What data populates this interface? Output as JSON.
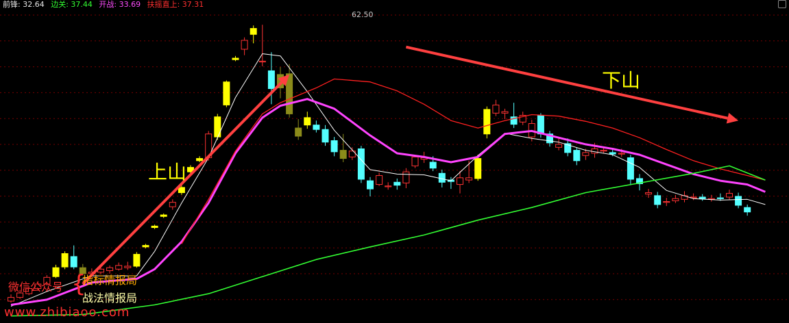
{
  "legend": [
    {
      "label": "前锋: 32.64",
      "color": "#e6e6e6"
    },
    {
      "label": "边关: 37.44",
      "color": "#32ff32"
    },
    {
      "label": "开战: 33.69",
      "color": "#ff4cff"
    },
    {
      "label": "扶摇直上: 37.31",
      "color": "#ff3030"
    }
  ],
  "annotations": {
    "up": "上山",
    "down": "下山",
    "peak": "62.50",
    "wechat": "微信公众号",
    "brace": "{",
    "line1": "指标情报局",
    "line2": "战法情报局",
    "url": "www.zhibiaoo.com"
  },
  "colors": {
    "background": "#000000",
    "grid": "#7a0000",
    "up_candle": "#ff3333",
    "down_candle": "#54ffff",
    "yellow_candle": "#ffff00",
    "olive_candle": "#8b8b1a",
    "arrow": "#ff4040"
  },
  "chart_data": {
    "type": "candlestick",
    "title": "",
    "ylim": [
      23,
      65
    ],
    "grid": true,
    "candles": [
      {
        "o": 25.3,
        "c": 25.8,
        "h": 26.2,
        "l": 25.1,
        "k": "up"
      },
      {
        "o": 25.8,
        "c": 26.4,
        "h": 26.8,
        "l": 25.6,
        "k": "up"
      },
      {
        "o": 26.3,
        "c": 27.0,
        "h": 27.3,
        "l": 26.1,
        "k": "up"
      },
      {
        "o": 27.0,
        "c": 27.6,
        "h": 28.0,
        "l": 26.8,
        "k": "up"
      },
      {
        "o": 27.6,
        "c": 28.5,
        "h": 28.8,
        "l": 27.4,
        "k": "up"
      },
      {
        "o": 28.6,
        "c": 29.8,
        "h": 30.2,
        "l": 28.4,
        "k": "yellow"
      },
      {
        "o": 29.9,
        "c": 31.7,
        "h": 32.0,
        "l": 29.6,
        "k": "yellow"
      },
      {
        "o": 31.3,
        "c": 29.9,
        "h": 32.8,
        "l": 29.6,
        "k": "down"
      },
      {
        "o": 29.8,
        "c": 29.0,
        "h": 30.3,
        "l": 28.8,
        "k": "olive"
      },
      {
        "o": 29.0,
        "c": 29.2,
        "h": 29.7,
        "l": 28.7,
        "k": "up"
      },
      {
        "o": 29.2,
        "c": 29.6,
        "h": 30.0,
        "l": 28.9,
        "k": "up"
      },
      {
        "o": 29.4,
        "c": 29.8,
        "h": 30.1,
        "l": 29.0,
        "k": "up"
      },
      {
        "o": 29.6,
        "c": 30.1,
        "h": 30.5,
        "l": 29.4,
        "k": "up"
      },
      {
        "o": 29.8,
        "c": 30.0,
        "h": 30.6,
        "l": 29.5,
        "k": "up"
      },
      {
        "o": 30.0,
        "c": 31.6,
        "h": 31.9,
        "l": 29.8,
        "k": "yellow"
      },
      {
        "o": 32.6,
        "c": 32.8,
        "h": 33.0,
        "l": 32.4,
        "k": "yellow"
      },
      {
        "o": 35.2,
        "c": 35.4,
        "h": 35.6,
        "l": 35.0,
        "k": "yellow"
      },
      {
        "o": 36.7,
        "c": 36.9,
        "h": 37.1,
        "l": 36.5,
        "k": "yellow"
      },
      {
        "o": 38.0,
        "c": 38.6,
        "h": 39.0,
        "l": 37.6,
        "k": "up"
      },
      {
        "o": 39.9,
        "c": 40.6,
        "h": 41.0,
        "l": 39.6,
        "k": "yellow"
      },
      {
        "o": 42.7,
        "c": 43.3,
        "h": 43.6,
        "l": 42.4,
        "k": "yellow"
      },
      {
        "o": 44.2,
        "c": 44.5,
        "h": 44.8,
        "l": 44.0,
        "k": "yellow"
      },
      {
        "o": 44.6,
        "c": 47.8,
        "h": 48.2,
        "l": 44.2,
        "k": "up"
      },
      {
        "o": 47.4,
        "c": 50.1,
        "h": 50.5,
        "l": 47.0,
        "k": "yellow"
      },
      {
        "o": 51.7,
        "c": 54.8,
        "h": 55.0,
        "l": 51.4,
        "k": "yellow"
      },
      {
        "o": 57.8,
        "c": 58.0,
        "h": 58.3,
        "l": 57.6,
        "k": "yellow"
      },
      {
        "o": 59.2,
        "c": 60.4,
        "h": 60.8,
        "l": 58.4,
        "k": "up"
      },
      {
        "o": 61.2,
        "c": 62.0,
        "h": 62.4,
        "l": 60.0,
        "k": "yellow"
      },
      {
        "o": 57.6,
        "c": 57.6,
        "h": 62.5,
        "l": 56.9,
        "k": "up"
      },
      {
        "o": 53.9,
        "c": 56.3,
        "h": 58.8,
        "l": 51.8,
        "k": "down"
      },
      {
        "o": 54.0,
        "c": 55.8,
        "h": 56.8,
        "l": 52.6,
        "k": "olive"
      },
      {
        "o": 55.9,
        "c": 50.5,
        "h": 57.2,
        "l": 50.0,
        "k": "olive"
      },
      {
        "o": 48.6,
        "c": 47.5,
        "h": 49.8,
        "l": 47.0,
        "k": "olive"
      },
      {
        "o": 49.0,
        "c": 50.0,
        "h": 50.8,
        "l": 48.5,
        "k": "yellow"
      },
      {
        "o": 49.0,
        "c": 48.4,
        "h": 49.6,
        "l": 48.0,
        "k": "down"
      },
      {
        "o": 48.4,
        "c": 46.7,
        "h": 49.0,
        "l": 46.2,
        "k": "down"
      },
      {
        "o": 46.9,
        "c": 45.4,
        "h": 47.4,
        "l": 44.8,
        "k": "down"
      },
      {
        "o": 45.6,
        "c": 44.5,
        "h": 47.8,
        "l": 44.0,
        "k": "olive"
      },
      {
        "o": 44.7,
        "c": 45.5,
        "h": 46.0,
        "l": 44.3,
        "k": "up"
      },
      {
        "o": 45.8,
        "c": 41.7,
        "h": 46.2,
        "l": 41.2,
        "k": "down"
      },
      {
        "o": 41.5,
        "c": 40.4,
        "h": 42.0,
        "l": 39.4,
        "k": "down"
      },
      {
        "o": 41.0,
        "c": 42.2,
        "h": 42.6,
        "l": 40.8,
        "k": "up"
      },
      {
        "o": 40.8,
        "c": 40.8,
        "h": 41.3,
        "l": 40.3,
        "k": "up"
      },
      {
        "o": 41.3,
        "c": 40.9,
        "h": 41.8,
        "l": 40.3,
        "k": "down"
      },
      {
        "o": 41.2,
        "c": 42.7,
        "h": 43.2,
        "l": 40.5,
        "k": "up"
      },
      {
        "o": 43.5,
        "c": 44.7,
        "h": 45.0,
        "l": 43.2,
        "k": "up"
      },
      {
        "o": 44.6,
        "c": 44.4,
        "h": 45.4,
        "l": 43.9,
        "k": "up"
      },
      {
        "o": 43.2,
        "c": 44.0,
        "h": 44.8,
        "l": 42.8,
        "k": "down"
      },
      {
        "o": 42.5,
        "c": 41.3,
        "h": 43.0,
        "l": 40.6,
        "k": "down"
      },
      {
        "o": 41.6,
        "c": 41.4,
        "h": 42.0,
        "l": 40.4,
        "k": "down"
      },
      {
        "o": 41.0,
        "c": 41.9,
        "h": 42.8,
        "l": 39.8,
        "k": "up"
      },
      {
        "o": 41.6,
        "c": 41.9,
        "h": 44.2,
        "l": 41.2,
        "k": "up"
      },
      {
        "o": 41.8,
        "c": 44.5,
        "h": 45.0,
        "l": 41.5,
        "k": "yellow"
      },
      {
        "o": 47.8,
        "c": 51.1,
        "h": 51.5,
        "l": 47.2,
        "k": "yellow"
      },
      {
        "o": 50.6,
        "c": 51.7,
        "h": 52.4,
        "l": 50.2,
        "k": "up"
      },
      {
        "o": 50.8,
        "c": 50.6,
        "h": 51.2,
        "l": 49.8,
        "k": "up"
      },
      {
        "o": 50.1,
        "c": 49.1,
        "h": 52.0,
        "l": 48.6,
        "k": "down"
      },
      {
        "o": 50.3,
        "c": 49.4,
        "h": 50.8,
        "l": 49.0,
        "k": "up"
      },
      {
        "o": 49.2,
        "c": 47.4,
        "h": 49.7,
        "l": 46.8,
        "k": "up"
      },
      {
        "o": 50.3,
        "c": 47.8,
        "h": 50.6,
        "l": 47.3,
        "k": "down"
      },
      {
        "o": 47.8,
        "c": 46.6,
        "h": 48.2,
        "l": 46.1,
        "k": "down"
      },
      {
        "o": 46.0,
        "c": 46.4,
        "h": 47.3,
        "l": 45.6,
        "k": "up"
      },
      {
        "o": 46.5,
        "c": 45.3,
        "h": 47.2,
        "l": 44.8,
        "k": "down"
      },
      {
        "o": 45.6,
        "c": 44.2,
        "h": 46.0,
        "l": 43.6,
        "k": "down"
      },
      {
        "o": 44.9,
        "c": 45.3,
        "h": 45.8,
        "l": 44.3,
        "k": "up"
      },
      {
        "o": 45.2,
        "c": 45.8,
        "h": 46.6,
        "l": 44.6,
        "k": "up"
      },
      {
        "o": 45.6,
        "c": 45.6,
        "h": 46.0,
        "l": 45.2,
        "k": "up"
      },
      {
        "o": 45.3,
        "c": 45.1,
        "h": 45.9,
        "l": 44.8,
        "k": "down"
      },
      {
        "o": 45.1,
        "c": 45.2,
        "h": 45.8,
        "l": 44.7,
        "k": "up"
      },
      {
        "o": 44.6,
        "c": 41.7,
        "h": 45.0,
        "l": 40.9,
        "k": "down"
      },
      {
        "o": 41.8,
        "c": 41.1,
        "h": 42.4,
        "l": 40.2,
        "k": "down"
      },
      {
        "o": 39.9,
        "c": 39.7,
        "h": 40.4,
        "l": 39.2,
        "k": "up"
      },
      {
        "o": 39.5,
        "c": 38.3,
        "h": 40.0,
        "l": 37.8,
        "k": "down"
      },
      {
        "o": 38.7,
        "c": 38.6,
        "h": 39.2,
        "l": 38.1,
        "k": "up"
      },
      {
        "o": 38.8,
        "c": 39.1,
        "h": 39.6,
        "l": 38.5,
        "k": "up"
      },
      {
        "o": 39.0,
        "c": 39.5,
        "h": 40.1,
        "l": 38.6,
        "k": "up"
      },
      {
        "o": 39.3,
        "c": 39.2,
        "h": 39.8,
        "l": 38.9,
        "k": "up"
      },
      {
        "o": 39.3,
        "c": 39.1,
        "h": 39.7,
        "l": 38.8,
        "k": "down"
      },
      {
        "o": 39.1,
        "c": 39.0,
        "h": 39.6,
        "l": 38.7,
        "k": "up"
      },
      {
        "o": 39.2,
        "c": 39.1,
        "h": 39.8,
        "l": 38.8,
        "k": "down"
      },
      {
        "o": 39.3,
        "c": 39.8,
        "h": 40.3,
        "l": 38.9,
        "k": "up"
      },
      {
        "o": 39.4,
        "c": 38.2,
        "h": 39.9,
        "l": 37.8,
        "k": "down"
      },
      {
        "o": 37.9,
        "c": 37.3,
        "h": 38.3,
        "l": 36.8,
        "k": "down"
      }
    ],
    "series": [
      {
        "name": "前锋",
        "color": "#ffffff",
        "width": 1,
        "values": [
          [
            0,
            24.6
          ],
          [
            4,
            26.6
          ],
          [
            9,
            28.7
          ],
          [
            14,
            28.7
          ],
          [
            16,
            32.0
          ],
          [
            19,
            38.5
          ],
          [
            22,
            44.6
          ],
          [
            25,
            52.7
          ],
          [
            28,
            58.6
          ],
          [
            30,
            58.3
          ],
          [
            33,
            53.5
          ],
          [
            36,
            48.3
          ],
          [
            40,
            43.0
          ],
          [
            43,
            42.4
          ],
          [
            46,
            42.3
          ],
          [
            49,
            41.5
          ],
          [
            52,
            44.9
          ],
          [
            55,
            47.9
          ],
          [
            58,
            47.2
          ],
          [
            61,
            46.7
          ],
          [
            64,
            45.6
          ],
          [
            67,
            45.0
          ],
          [
            70,
            43.3
          ],
          [
            73,
            40.2
          ],
          [
            76,
            39.1
          ],
          [
            79,
            38.9
          ],
          [
            82,
            39.0
          ],
          [
            84,
            38.3
          ]
        ]
      },
      {
        "name": "开战",
        "color": "#ff44ff",
        "width": 3,
        "values": [
          [
            0,
            24.8
          ],
          [
            4,
            25.5
          ],
          [
            9,
            27.8
          ],
          [
            14,
            28.3
          ],
          [
            16,
            29.6
          ],
          [
            19,
            33.3
          ],
          [
            22,
            38.5
          ],
          [
            25,
            45.2
          ],
          [
            28,
            50.0
          ],
          [
            30,
            51.6
          ],
          [
            33,
            52.5
          ],
          [
            36,
            51.2
          ],
          [
            40,
            47.6
          ],
          [
            43,
            45.2
          ],
          [
            46,
            44.7
          ],
          [
            49,
            44.0
          ],
          [
            52,
            44.7
          ],
          [
            55,
            47.8
          ],
          [
            58,
            48.2
          ],
          [
            61,
            47.3
          ],
          [
            64,
            46.4
          ],
          [
            67,
            45.8
          ],
          [
            70,
            45.0
          ],
          [
            73,
            43.7
          ],
          [
            76,
            42.4
          ],
          [
            79,
            41.5
          ],
          [
            82,
            41.0
          ],
          [
            84,
            40.0
          ]
        ]
      },
      {
        "name": "扶摇直上",
        "color": "#ff2020",
        "width": 1.3,
        "values": [
          [
            19,
            33.0
          ],
          [
            22,
            39.0
          ],
          [
            25,
            45.5
          ],
          [
            28,
            50.5
          ],
          [
            30,
            52.0
          ],
          [
            34,
            54.0
          ],
          [
            36,
            55.2
          ],
          [
            40,
            54.8
          ],
          [
            43,
            53.6
          ],
          [
            46,
            51.8
          ],
          [
            49,
            49.6
          ],
          [
            52,
            48.6
          ],
          [
            55,
            49.6
          ],
          [
            58,
            50.4
          ],
          [
            61,
            50.2
          ],
          [
            64,
            49.5
          ],
          [
            67,
            48.6
          ],
          [
            70,
            47.3
          ],
          [
            73,
            45.7
          ],
          [
            76,
            44.2
          ],
          [
            79,
            43.1
          ],
          [
            82,
            42.2
          ],
          [
            84,
            41.6
          ]
        ]
      },
      {
        "name": "边关",
        "color": "#33ff33",
        "width": 1.6,
        "values": [
          [
            0,
            23.3
          ],
          [
            8,
            23.5
          ],
          [
            16,
            24.8
          ],
          [
            22,
            26.3
          ],
          [
            28,
            28.6
          ],
          [
            34,
            30.9
          ],
          [
            40,
            32.6
          ],
          [
            46,
            34.2
          ],
          [
            52,
            36.2
          ],
          [
            58,
            37.9
          ],
          [
            64,
            39.9
          ],
          [
            70,
            41.2
          ],
          [
            76,
            42.5
          ],
          [
            80,
            43.5
          ],
          [
            84,
            41.6
          ]
        ]
      }
    ],
    "arrows": [
      {
        "from": [
          8,
          27.6
        ],
        "to": [
          31,
          55.8
        ]
      },
      {
        "from": [
          44,
          59.5
        ],
        "to": [
          81,
          49.6
        ]
      }
    ]
  }
}
